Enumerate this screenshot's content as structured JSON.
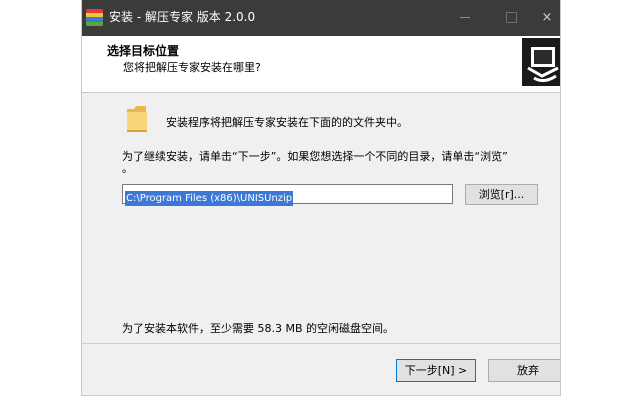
{
  "window": {
    "title": "安装 - 解压专家 版本 2.0.0",
    "minimize_glyph": "",
    "maximize_glyph": "",
    "close_glyph": "×"
  },
  "header": {
    "title": "选择目标位置",
    "subtitle": "您将把解压专家安装在哪里?"
  },
  "body": {
    "description": "安装程序将把解压专家安装在下面的的文件夹中。",
    "instruction_line1": "为了继续安装，请单击“下一步”。如果您想选择一个不同的目录，请单击“浏览”",
    "instruction_line2": "。",
    "install_path": "C:\\Program Files (x86)\\UNISUnzip",
    "browse_label": "浏览[r]...",
    "space_required": "为了安装本软件，至少需要 58.3 MB 的空闲磁盘空间。"
  },
  "footer": {
    "next_label": "下一步[N] >",
    "cancel_label": "放弃"
  },
  "icons": {
    "app": "winrar-books-icon",
    "folder": "folder-icon",
    "header_logo": "installer-box-icon"
  },
  "colors": {
    "titlebar": "#3b3b3b",
    "selection": "#3c78d8",
    "default_button_border": "#0078d7"
  }
}
